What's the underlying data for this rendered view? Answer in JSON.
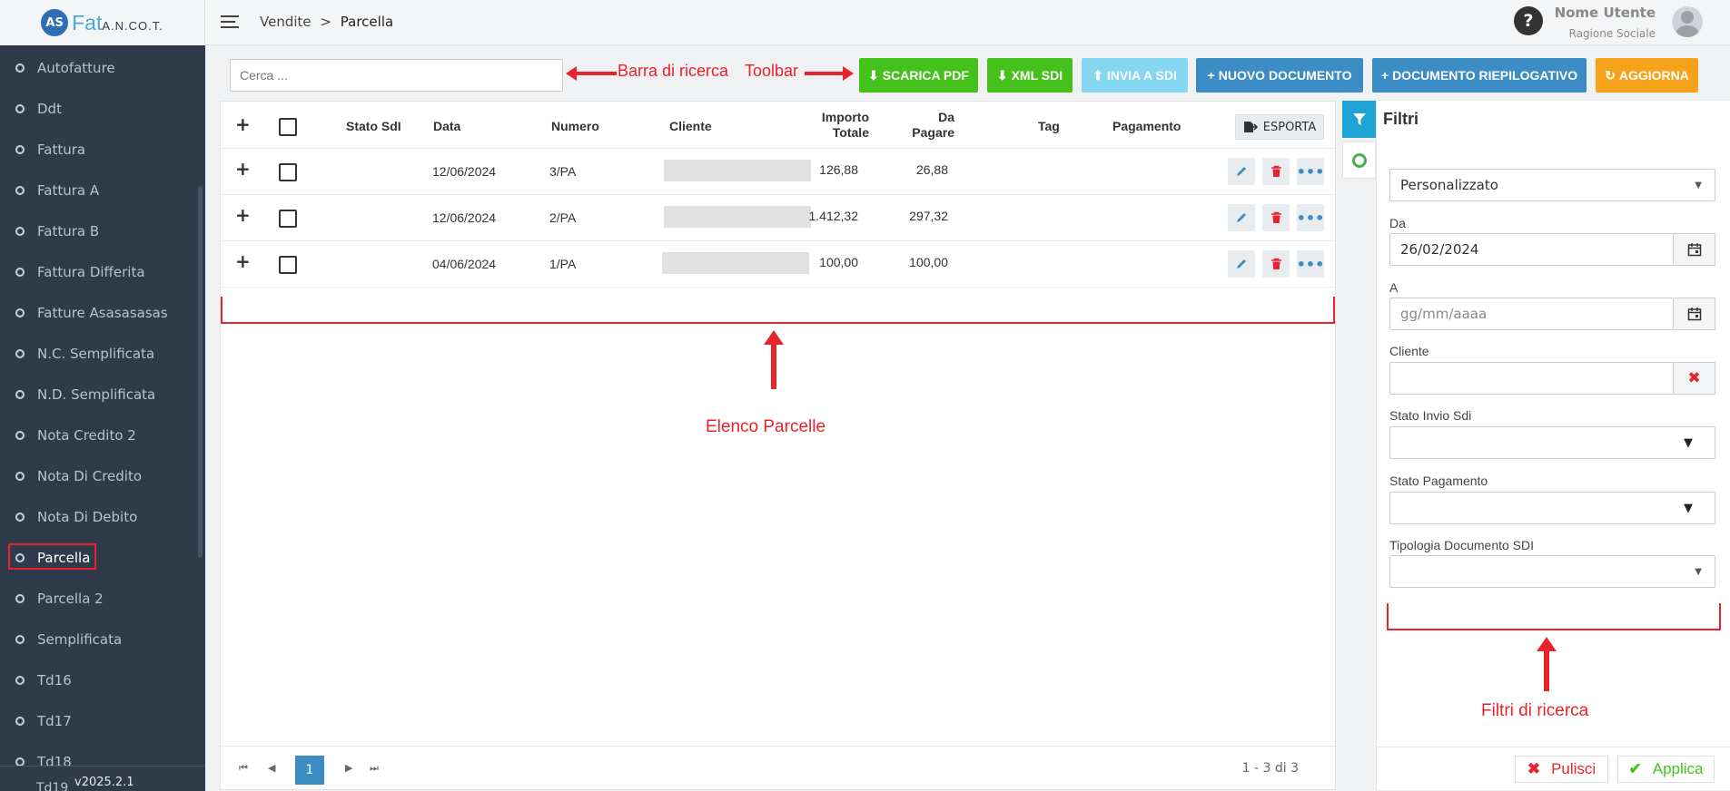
{
  "app": {
    "logo_mark": "AS",
    "logo_text": "Fat",
    "logo_suffix": "A.N.CO.T.",
    "version": "v2025.2.1"
  },
  "header": {
    "breadcrumb_parent": "Vendite",
    "breadcrumb_sep": ">",
    "breadcrumb_current": "Parcella",
    "help_icon": "?",
    "user_name": "Nome Utente",
    "user_sub": "Ragione Sociale"
  },
  "sidebar": {
    "items": [
      {
        "label": "Autofatture"
      },
      {
        "label": "Ddt"
      },
      {
        "label": "Fattura"
      },
      {
        "label": "Fattura A"
      },
      {
        "label": "Fattura B"
      },
      {
        "label": "Fattura Differita"
      },
      {
        "label": "Fatture Asasasasas"
      },
      {
        "label": "N.C. Semplificata"
      },
      {
        "label": "N.D. Semplificata"
      },
      {
        "label": "Nota Credito 2"
      },
      {
        "label": "Nota Di Credito"
      },
      {
        "label": "Nota Di Debito"
      },
      {
        "label": "Parcella"
      },
      {
        "label": "Parcella 2"
      },
      {
        "label": "Semplificata"
      },
      {
        "label": "Td16"
      },
      {
        "label": "Td17"
      },
      {
        "label": "Td18"
      }
    ],
    "active_index": 12,
    "peek_label": "Td19"
  },
  "toolbar": {
    "search_placeholder": "Cerca ...",
    "btn_pdf": "SCARICA PDF",
    "btn_xml": "XML SDI",
    "btn_send": "INVIA A SDI",
    "btn_new": "NUOVO DOCUMENTO",
    "btn_summary": "DOCUMENTO RIEPILOGATIVO",
    "btn_refresh": "AGGIORNA"
  },
  "annotations": {
    "search": "Barra di ricerca",
    "toolbar": "Toolbar",
    "list": "Elenco Parcelle",
    "filters": "Filtri di ricerca"
  },
  "table": {
    "col_status": "Stato SdI",
    "col_date": "Data",
    "col_number": "Numero",
    "col_client": "Cliente",
    "col_total_1": "Importo",
    "col_total_2": "Totale",
    "col_due_1": "Da",
    "col_due_2": "Pagare",
    "col_tag": "Tag",
    "col_payment": "Pagamento",
    "export_label": "ESPORTA",
    "rows": [
      {
        "date": "12/06/2024",
        "number": "3/PA",
        "total": "126,88",
        "due": "26,88"
      },
      {
        "date": "12/06/2024",
        "number": "2/PA",
        "total": "1.412,32",
        "due": "297,32"
      },
      {
        "date": "04/06/2024",
        "number": "1/PA",
        "total": "100,00",
        "due": "100,00"
      }
    ]
  },
  "pager": {
    "current_page": "1",
    "info": "1 - 3 di 3"
  },
  "filters": {
    "title": "Filtri",
    "period_value": "Personalizzato",
    "from_label": "Da",
    "from_value": "26/02/2024",
    "to_label": "A",
    "to_placeholder": "gg/mm/aaaa",
    "client_label": "Cliente",
    "sdi_status_label": "Stato Invio Sdi",
    "payment_status_label": "Stato Pagamento",
    "doc_type_label": "Tipologia Documento SDI",
    "clear_label": "Pulisci",
    "apply_label": "Applica"
  },
  "colors": {
    "sidebar_bg": "#2f3a4a",
    "green": "#44c11b",
    "blue": "#3c8dc5",
    "orange": "#f7a21b",
    "light_blue": "#85d6f0",
    "annotation_red": "#e8232c"
  }
}
